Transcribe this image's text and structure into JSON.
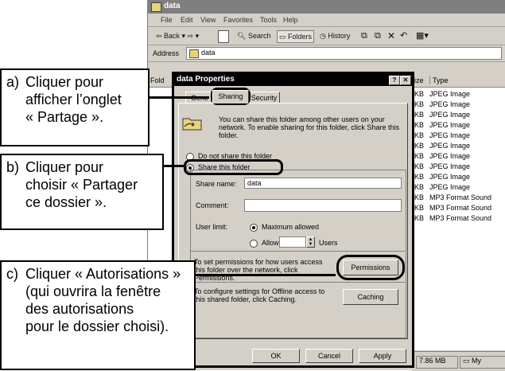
{
  "explorer": {
    "title": "data",
    "menu": [
      "File",
      "Edit",
      "View",
      "Favorites",
      "Tools",
      "Help"
    ],
    "toolbar": {
      "back": "⇦ Back ▾ ⇨ ▾",
      "search": "Search",
      "folders": "Folders",
      "history": "History"
    },
    "address_label": "Address",
    "address_value": "data",
    "left_header": "Fold",
    "columns": {
      "size": "ize",
      "type": "Type"
    },
    "files": [
      {
        "size": "KB",
        "type": "JPEG Image"
      },
      {
        "size": "KB",
        "type": "JPEG Image"
      },
      {
        "size": "KB",
        "type": "JPEG Image"
      },
      {
        "size": "KB",
        "type": "JPEG Image"
      },
      {
        "size": "KB",
        "type": "JPEG Image"
      },
      {
        "size": "KB",
        "type": "JPEG Image"
      },
      {
        "size": "KB",
        "type": "JPEG Image"
      },
      {
        "size": "KB",
        "type": "JPEG Image"
      },
      {
        "size": "KB",
        "type": "JPEG Image"
      },
      {
        "size": "KB",
        "type": "JPEG Image"
      },
      {
        "size": "KB",
        "type": "MP3 Format Sound"
      },
      {
        "size": "KB",
        "type": "MP3 Format Sound"
      },
      {
        "size": "KB",
        "type": "MP3 Format Sound"
      }
    ],
    "status_size": "7.86 MB",
    "status_location": "My"
  },
  "dialog": {
    "title": "data Properties",
    "help_btn": "?",
    "close_btn": "✕",
    "tabs": {
      "general": "Gene",
      "sharing": "Sharing",
      "security": "Security"
    },
    "description": "You can share this folder among other users on your network. To enable sharing for this folder, click Share this folder.",
    "radio_not_share": "Do not share this folder",
    "radio_share": "Share this folder",
    "share_name_label": "Share name:",
    "share_name_value": "data",
    "comment_label": "Comment:",
    "comment_value": "",
    "user_limit_label": "User limit:",
    "max_allowed": "Maximum allowed",
    "allow": "Allow",
    "users": "Users",
    "permissions_text": "To set permissions for how users access this folder over the network, click Permissions.",
    "permissions_btn": "Permissions",
    "caching_text": "To configure settings for Offline access to this shared folder, click Caching.",
    "caching_btn": "Caching",
    "ok": "OK",
    "cancel": "Cancel",
    "apply": "Apply"
  },
  "notes": {
    "a": {
      "letter": "a)",
      "lines": [
        "Cliquer pour",
        "afficher l’onglet",
        "« Partage »."
      ]
    },
    "b": {
      "letter": "b)",
      "lines": [
        "Cliquer pour",
        "choisir « Partager",
        "ce dossier »."
      ]
    },
    "c": {
      "letter": "c)",
      "lines": [
        "Cliquer « Autorisations »",
        "(qui ouvrira la fenêtre",
        "des autorisations",
        "pour le dossier choisi)."
      ]
    }
  }
}
